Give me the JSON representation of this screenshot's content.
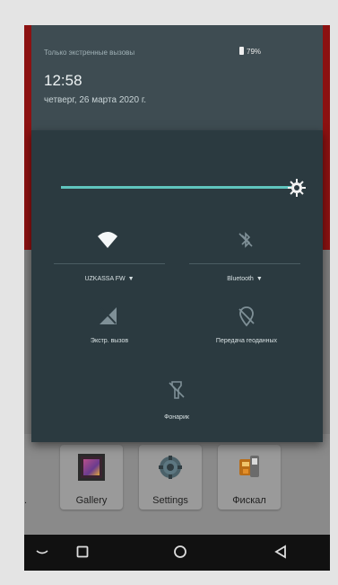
{
  "status": {
    "emergency_text": "Только экстренные вызовы",
    "battery": "79%"
  },
  "clock": {
    "time": "12:58",
    "date": "четверг, 26 марта 2020 г."
  },
  "brightness": {
    "level": 0.98,
    "icon": "brightness-icon"
  },
  "tiles": [
    {
      "label": "UZKASSA FW",
      "icon": "wifi-icon",
      "dropdown": true
    },
    {
      "label": "Bluetooth",
      "icon": "bluetooth-off-icon",
      "dropdown": true
    },
    {
      "label": "Экстр. вызов",
      "icon": "emergency-call-icon"
    },
    {
      "label": "Передача геоданных",
      "icon": "location-off-icon"
    },
    {
      "label": "Фонарик",
      "icon": "flashlight-off-icon"
    }
  ],
  "apps": [
    {
      "label": "Gallery",
      "icon": "gallery-icon"
    },
    {
      "label": "Settings",
      "icon": "settings-icon"
    },
    {
      "label": "Фискал",
      "icon": "fiscal-icon"
    }
  ],
  "partial_app_label": ".",
  "nav": [
    "back-icon",
    "recents-icon",
    "home-icon",
    "back-triangle-icon"
  ]
}
